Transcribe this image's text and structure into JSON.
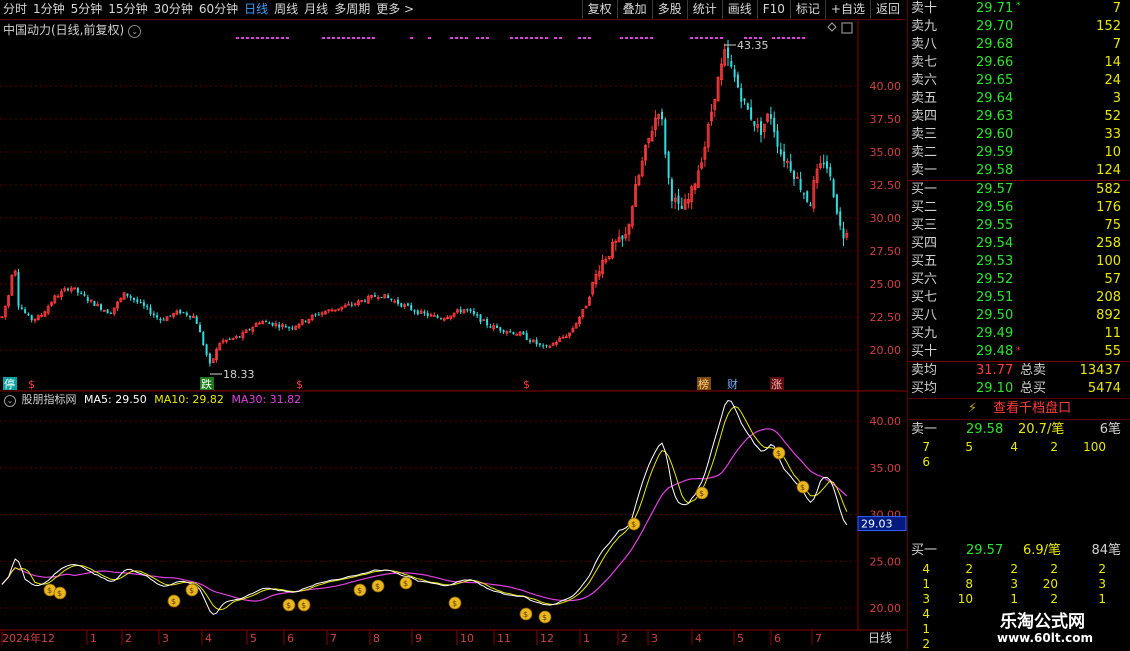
{
  "topbar": {
    "tabs": [
      "分时",
      "1分钟",
      "5分钟",
      "15分钟",
      "30分钟",
      "60分钟",
      "日线",
      "周线",
      "月线",
      "多周期",
      "更多 >"
    ],
    "active_tab": "日线",
    "tools": [
      "复权",
      "叠加",
      "多股",
      "统计",
      "画线",
      "F10",
      "标记",
      "+自选",
      "返回"
    ]
  },
  "stock": {
    "title": "中国动力(日线,前复权)"
  },
  "main_chart": {
    "y_ticks": [
      "40.00",
      "37.50",
      "35.00",
      "32.50",
      "30.00",
      "27.50",
      "25.00",
      "22.50",
      "20.00"
    ],
    "high_label": "43.35",
    "low_label": "18.33",
    "markers": [
      "停",
      "$",
      "跌",
      "$",
      "$",
      "榜",
      "财",
      "涨"
    ]
  },
  "indicator": {
    "name": "股朋指标网",
    "ma5": "MA5: 29.50",
    "ma10": "MA10: 29.82",
    "ma30": "MA30: 31.82",
    "y_ticks": [
      "40.00",
      "35.00",
      "30.00",
      "25.00",
      "20.00"
    ],
    "current_value": "29.03"
  },
  "x_axis": {
    "labels": [
      "2024年12",
      "1",
      "2",
      "3",
      "4",
      "5",
      "6",
      "7",
      "8",
      "9",
      "10",
      "11",
      "12",
      "1",
      "2",
      "3",
      "4",
      "5",
      "6",
      "7"
    ],
    "period": "日线"
  },
  "order_book": {
    "asks": [
      {
        "label": "卖十",
        "price": "29.71",
        "vol": "7"
      },
      {
        "label": "卖九",
        "price": "29.70",
        "vol": "152"
      },
      {
        "label": "卖八",
        "price": "29.68",
        "vol": "7"
      },
      {
        "label": "卖七",
        "price": "29.66",
        "vol": "14"
      },
      {
        "label": "卖六",
        "price": "29.65",
        "vol": "24"
      },
      {
        "label": "卖五",
        "price": "29.64",
        "vol": "3"
      },
      {
        "label": "卖四",
        "price": "29.63",
        "vol": "52"
      },
      {
        "label": "卖三",
        "price": "29.60",
        "vol": "33"
      },
      {
        "label": "卖二",
        "price": "29.59",
        "vol": "10"
      },
      {
        "label": "卖一",
        "price": "29.58",
        "vol": "124"
      }
    ],
    "bids": [
      {
        "label": "买一",
        "price": "29.57",
        "vol": "582"
      },
      {
        "label": "买二",
        "price": "29.56",
        "vol": "176"
      },
      {
        "label": "买三",
        "price": "29.55",
        "vol": "75"
      },
      {
        "label": "买四",
        "price": "29.54",
        "vol": "258"
      },
      {
        "label": "买五",
        "price": "29.53",
        "vol": "100"
      },
      {
        "label": "买六",
        "price": "29.52",
        "vol": "57"
      },
      {
        "label": "买七",
        "price": "29.51",
        "vol": "208"
      },
      {
        "label": "买八",
        "price": "29.50",
        "vol": "892"
      },
      {
        "label": "买九",
        "price": "29.49",
        "vol": "11"
      },
      {
        "label": "买十",
        "price": "29.48",
        "vol": "55"
      }
    ],
    "ask_avg_label": "卖均",
    "ask_avg": "31.77",
    "total_sell_label": "总卖",
    "total_sell": "13437",
    "bid_avg_label": "买均",
    "bid_avg": "29.10",
    "total_buy_label": "总买",
    "total_buy": "5474",
    "view_1000_label": "查看千档盘口",
    "sell1": {
      "label": "卖一",
      "price": "29.58",
      "per": "20.7/笔",
      "count": "6笔"
    },
    "sell1_queue": [
      [
        "7",
        "5",
        "4",
        "2",
        "100"
      ],
      [
        "6",
        "",
        "",
        "",
        ""
      ]
    ],
    "buy1": {
      "label": "买一",
      "price": "29.57",
      "per": "6.9/笔",
      "count": "84笔"
    },
    "buy1_queue": [
      [
        "4",
        "2",
        "2",
        "2",
        "2"
      ],
      [
        "1",
        "8",
        "3",
        "20",
        "3"
      ],
      [
        "3",
        "10",
        "1",
        "2",
        "1"
      ],
      [
        "4",
        "",
        "",
        "",
        ""
      ],
      [
        "1",
        "",
        "",
        "",
        ""
      ],
      [
        "2",
        "",
        "",
        "",
        ""
      ]
    ]
  },
  "watermark": {
    "title": "乐淘公式网",
    "url": "www.60lt.com"
  },
  "colors": {
    "up": "#ff3b3b",
    "down": "#2fdede",
    "ma5": "#ffffff",
    "ma10": "#e8e800",
    "ma30": "#e040e0",
    "grid": "#5a0000"
  }
}
